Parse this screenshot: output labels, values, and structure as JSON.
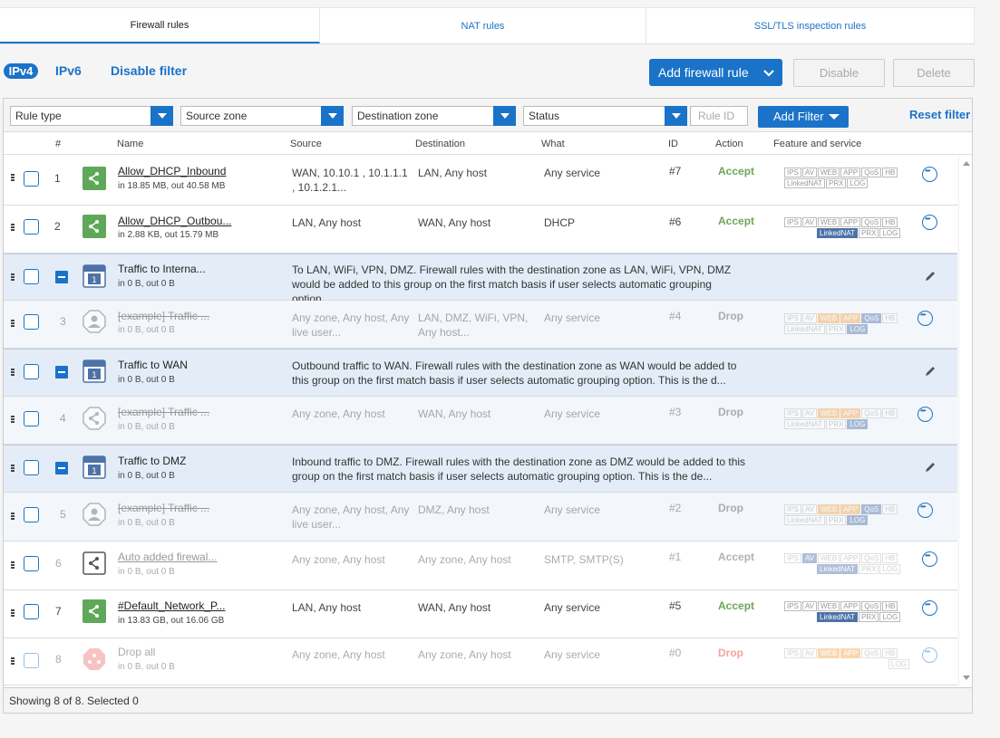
{
  "tabs": [
    "Firewall rules",
    "NAT rules",
    "SSL/TLS inspection rules"
  ],
  "toolbar": {
    "ipv4": "IPv4",
    "ipv6": "IPv6",
    "disable_filter": "Disable filter",
    "add_rule": "Add firewall rule",
    "disable": "Disable",
    "delete": "Delete"
  },
  "filters": {
    "rule_type": "Rule type",
    "source_zone": "Source zone",
    "destination_zone": "Destination zone",
    "status": "Status",
    "rule_id_placeholder": "Rule ID",
    "add_filter": "Add Filter",
    "reset_filter": "Reset filter"
  },
  "columns": {
    "num": "#",
    "name": "Name",
    "source": "Source",
    "destination": "Destination",
    "what": "What",
    "id": "ID",
    "action": "Action",
    "feature": "Feature and service"
  },
  "rows": {
    "r1": {
      "num": "1",
      "name": "Allow_DHCP_Inbound",
      "sub": "in 18.85 MB, out 40.58 MB",
      "source": "WAN, 10.10.1 , 10.1.1.1 , 10.1.2.1...",
      "destination": "LAN, Any host",
      "what": "Any service",
      "id": "#7",
      "action": "Accept"
    },
    "r2": {
      "num": "2",
      "name": "Allow_DHCP_Outbou...",
      "sub": "in 2.88 KB, out 15.79 MB",
      "source": "LAN, Any host",
      "destination": "WAN, Any host",
      "what": "DHCP",
      "id": "#6",
      "action": "Accept"
    },
    "g1": {
      "name": "Traffic to Interna...",
      "sub": "in 0 B, out 0 B",
      "desc": "To LAN, WiFi, VPN, DMZ. Firewall rules with the destination zone as LAN, WiFi, VPN, DMZ would be added to this group on the first match basis if user selects automatic grouping option..."
    },
    "r3": {
      "num": "3",
      "name": "[example] Traffic ...",
      "sub": "in 0 B, out 0 B",
      "source": "Any zone, Any host, Any live user...",
      "destination": "LAN, DMZ, WiFi, VPN, Any host...",
      "what": "Any service",
      "id": "#4",
      "action": "Drop"
    },
    "g2": {
      "name": "Traffic to WAN",
      "sub": "in 0 B, out 0 B",
      "desc": "Outbound traffic to WAN. Firewall rules with the destination zone as WAN would be added to this group on the first match basis if user selects automatic grouping option. This is the d..."
    },
    "r4": {
      "num": "4",
      "name": "[example] Traffic ...",
      "sub": "in 0 B, out 0 B",
      "source": "Any zone, Any host",
      "destination": "WAN, Any host",
      "what": "Any service",
      "id": "#3",
      "action": "Drop"
    },
    "g3": {
      "name": "Traffic to DMZ",
      "sub": "in 0 B, out 0 B",
      "desc": "Inbound traffic to DMZ. Firewall rules with the destination zone as DMZ would be added to this group on the first match basis if user selects automatic grouping option. This is the de..."
    },
    "r5": {
      "num": "5",
      "name": "[example] Traffic ...",
      "sub": "in 0 B, out 0 B",
      "source": "Any zone, Any host, Any live user...",
      "destination": "DMZ, Any host",
      "what": "Any service",
      "id": "#2",
      "action": "Drop"
    },
    "r6": {
      "num": "6",
      "name": "Auto added firewal...",
      "sub": "in 0 B, out 0 B",
      "source": "Any zone, Any host",
      "destination": "Any zone, Any host",
      "what": "SMTP, SMTP(S)",
      "id": "#1",
      "action": "Accept"
    },
    "r7": {
      "num": "7",
      "name": "#Default_Network_P...",
      "sub": "in 13.83 GB, out 16.06 GB",
      "source": "LAN, Any host",
      "destination": "WAN, Any host",
      "what": "Any service",
      "id": "#5",
      "action": "Accept"
    },
    "r8": {
      "num": "8",
      "name": "Drop all",
      "sub": "in 0 B, out 0 B",
      "source": "Any zone, Any host",
      "destination": "Any zone, Any host",
      "what": "Any service",
      "id": "#0",
      "action": "Drop"
    }
  },
  "features": {
    "ips": "IPS",
    "av": "AV",
    "web": "WEB",
    "app": "APP",
    "qos": "QoS",
    "hb": "HB",
    "linkednat": "LinkedNAT",
    "prx": "PRX",
    "log": "LOG"
  },
  "footer": "Showing 8 of 8. Selected 0",
  "colors": {
    "accent": "#1a73c8",
    "accept": "#6ea65a",
    "drop": "#888888",
    "group_bg": "#e4edf7"
  }
}
